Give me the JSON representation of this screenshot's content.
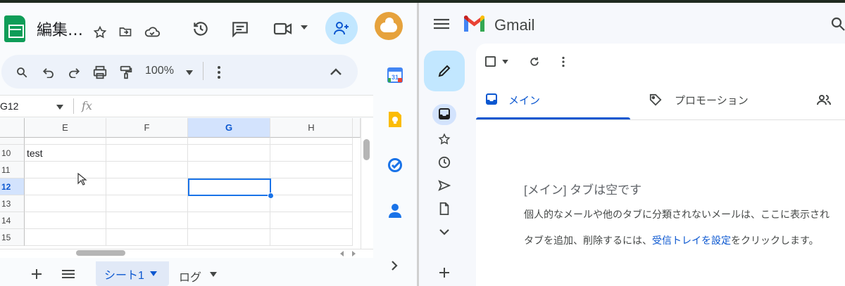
{
  "sheets": {
    "title": "編集…",
    "zoom": "100%",
    "name_box": "G12",
    "fx": "fx",
    "columns": [
      "E",
      "F",
      "G",
      "H"
    ],
    "rows": [
      "10",
      "11",
      "12",
      "13",
      "14",
      "15"
    ],
    "cell_e10": "test",
    "tabs": {
      "active": "シート1",
      "other": "ログ"
    }
  },
  "gmail": {
    "brand": "Gmail",
    "tabs": {
      "main": "メイン",
      "promotions": "プロモーション"
    },
    "empty_title": "[メイン] タブは空です",
    "empty_line1": "個人的なメールや他のタブに分類されないメールは、ここに表示され",
    "empty_line2_before": "タブを追加、削除するには、",
    "empty_line2_link": "受信トレイを設定",
    "empty_line2_after": "をクリックします。"
  }
}
